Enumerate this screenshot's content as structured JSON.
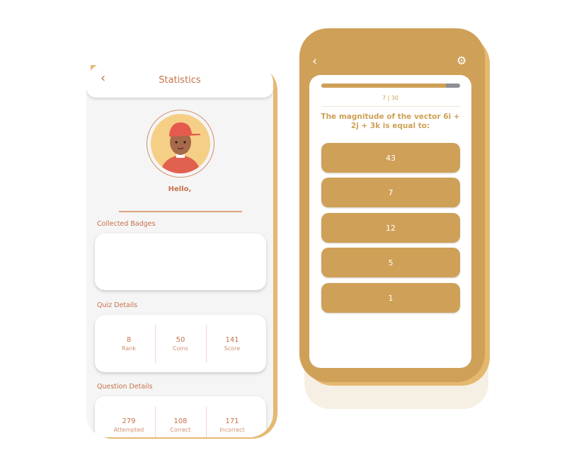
{
  "stats_screen": {
    "title": "Statistics",
    "greeting": "Hello,",
    "sections": {
      "badges": "Collected Badges",
      "quiz": "Quiz Details",
      "questions": "Question Details"
    },
    "quiz_details": [
      {
        "value": "8",
        "label": "Rank"
      },
      {
        "value": "50",
        "label": "Coins"
      },
      {
        "value": "141",
        "label": "Score"
      }
    ],
    "question_details": [
      {
        "value": "279",
        "label": "Attempted"
      },
      {
        "value": "108",
        "label": "Correct"
      },
      {
        "value": "171",
        "label": "Incorrect"
      }
    ]
  },
  "quiz_screen": {
    "progress_text": "7 | 30",
    "progress_fraction": 0.9,
    "question": "The magnitude of the vector 6i + 2j + 3k is equal to:",
    "options": [
      "43",
      "7",
      "12",
      "5",
      "1"
    ]
  },
  "colors": {
    "accent": "#CFA057",
    "text": "#C8714A"
  },
  "icons": {
    "back": "chevron-left-icon",
    "settings": "gear-icon"
  }
}
